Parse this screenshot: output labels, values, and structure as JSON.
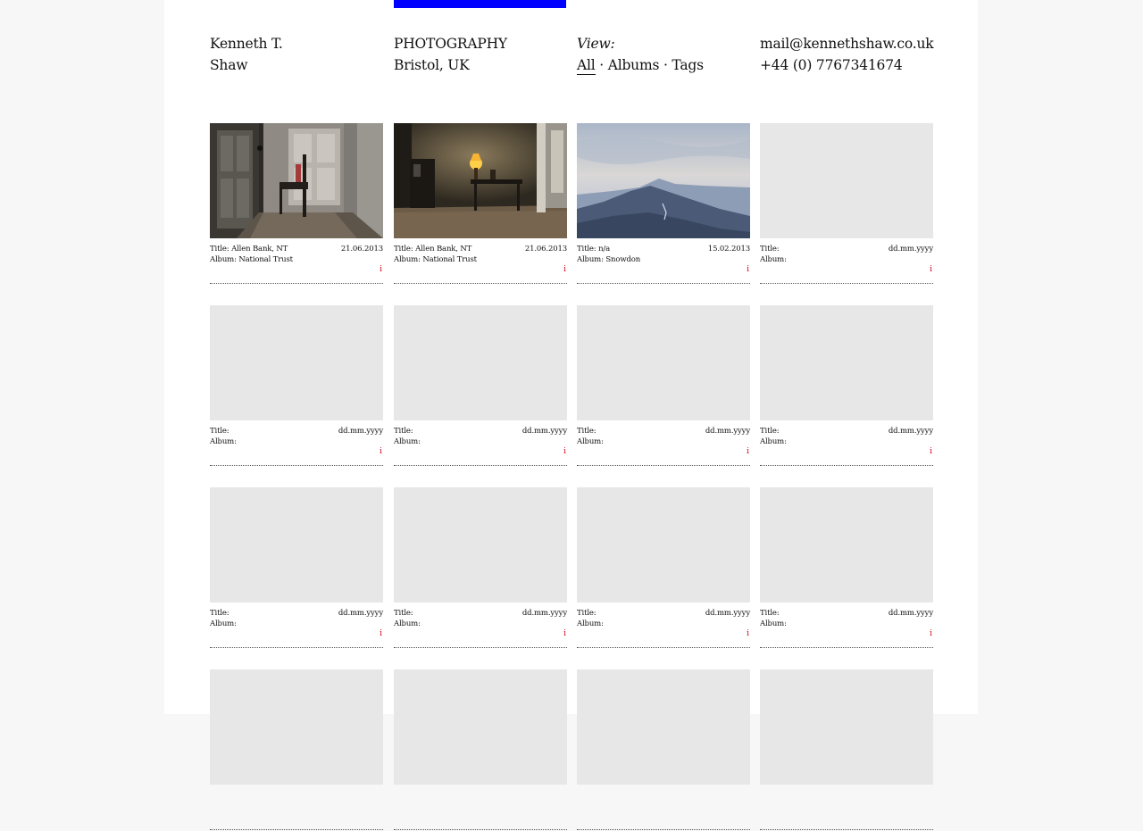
{
  "colors": {
    "accent": "#0000ff",
    "info": "#d0021b",
    "placeholder": "#e7e7e7"
  },
  "header": {
    "name_line1": "Kenneth T.",
    "name_line2": "Shaw",
    "discipline": "PHOTOGRAPHY",
    "location": "Bristol, UK",
    "view_label": "View:",
    "view_links": [
      "All",
      "Albums",
      "Tags"
    ],
    "view_separator": " · ",
    "email": "mail@kennethshaw.co.uk",
    "phone": "+44 (0) 7767341674"
  },
  "grid": [
    {
      "title": "Title: Allen Bank, NT",
      "album": "Album: National Trust",
      "date": "21.06.2013",
      "info": "i",
      "image": "interior-chair"
    },
    {
      "title": "Title: Allen Bank, NT",
      "album": "Album: National Trust",
      "date": "21.06.2013",
      "info": "i",
      "image": "interior-lamp"
    },
    {
      "title": "Title: n/a",
      "album": "Album: Snowdon",
      "date": "15.02.2013",
      "info": "i",
      "image": "mountain"
    },
    {
      "title": "Title:",
      "album": "Album:",
      "date": "dd.mm.yyyy",
      "info": "i",
      "image": "placeholder"
    },
    {
      "title": "Title:",
      "album": "Album:",
      "date": "dd.mm.yyyy",
      "info": "i",
      "image": "placeholder"
    },
    {
      "title": "Title:",
      "album": "Album:",
      "date": "dd.mm.yyyy",
      "info": "i",
      "image": "placeholder"
    },
    {
      "title": "Title:",
      "album": "Album:",
      "date": "dd.mm.yyyy",
      "info": "i",
      "image": "placeholder"
    },
    {
      "title": "Title:",
      "album": "Album:",
      "date": "dd.mm.yyyy",
      "info": "i",
      "image": "placeholder"
    },
    {
      "title": "Title:",
      "album": "Album:",
      "date": "dd.mm.yyyy",
      "info": "i",
      "image": "placeholder"
    },
    {
      "title": "Title:",
      "album": "Album:",
      "date": "dd.mm.yyyy",
      "info": "i",
      "image": "placeholder"
    },
    {
      "title": "Title:",
      "album": "Album:",
      "date": "dd.mm.yyyy",
      "info": "i",
      "image": "placeholder"
    },
    {
      "title": "Title:",
      "album": "Album:",
      "date": "dd.mm.yyyy",
      "info": "i",
      "image": "placeholder"
    },
    {
      "title": "",
      "album": "",
      "date": "",
      "info": "",
      "image": "placeholder"
    },
    {
      "title": "",
      "album": "",
      "date": "",
      "info": "",
      "image": "placeholder"
    },
    {
      "title": "",
      "album": "",
      "date": "",
      "info": "",
      "image": "placeholder"
    },
    {
      "title": "",
      "album": "",
      "date": "",
      "info": "",
      "image": "placeholder"
    }
  ]
}
